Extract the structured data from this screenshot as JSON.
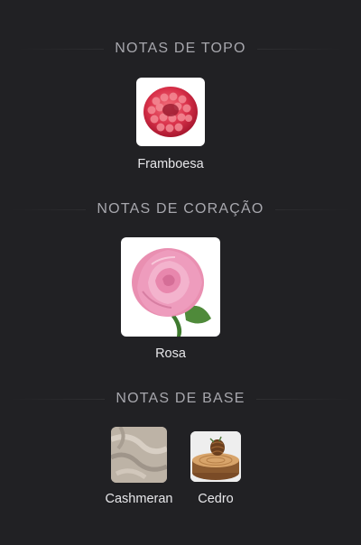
{
  "sections": [
    {
      "title": "NOTAS DE TOPO",
      "notes": [
        {
          "label": "Framboesa",
          "icon": "raspberry-icon"
        }
      ]
    },
    {
      "title": "NOTAS DE CORAÇÃO",
      "notes": [
        {
          "label": "Rosa",
          "icon": "rose-icon"
        }
      ]
    },
    {
      "title": "NOTAS DE BASE",
      "notes": [
        {
          "label": "Cashmeran",
          "icon": "cashmere-fabric-icon"
        },
        {
          "label": "Cedro",
          "icon": "cedar-wood-icon"
        }
      ]
    }
  ],
  "colors": {
    "background": "#212124",
    "heading": "#a7a7ad",
    "label": "#e7e7ea"
  }
}
